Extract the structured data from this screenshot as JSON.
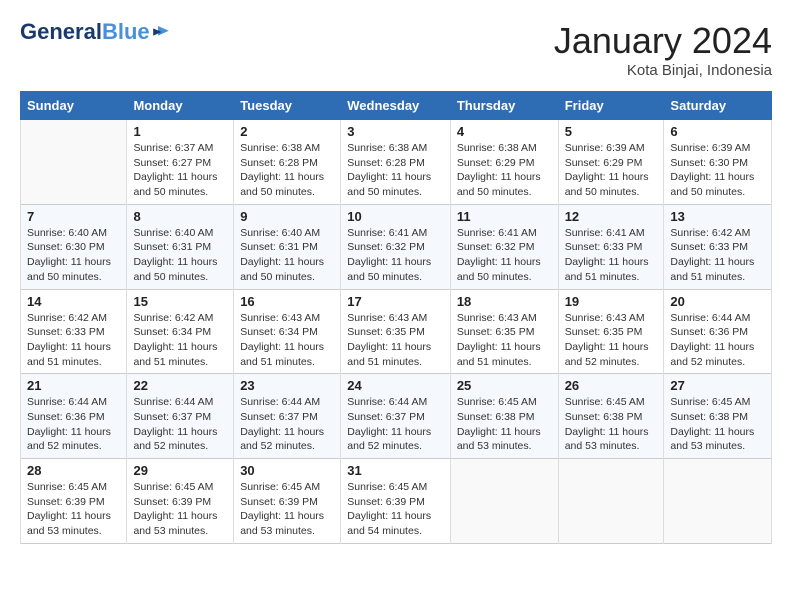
{
  "header": {
    "logo_line1": "General",
    "logo_line2": "Blue",
    "month_title": "January 2024",
    "location": "Kota Binjai, Indonesia"
  },
  "days_of_week": [
    "Sunday",
    "Monday",
    "Tuesday",
    "Wednesday",
    "Thursday",
    "Friday",
    "Saturday"
  ],
  "weeks": [
    [
      {
        "num": "",
        "info": ""
      },
      {
        "num": "1",
        "info": "Sunrise: 6:37 AM\nSunset: 6:27 PM\nDaylight: 11 hours\nand 50 minutes."
      },
      {
        "num": "2",
        "info": "Sunrise: 6:38 AM\nSunset: 6:28 PM\nDaylight: 11 hours\nand 50 minutes."
      },
      {
        "num": "3",
        "info": "Sunrise: 6:38 AM\nSunset: 6:28 PM\nDaylight: 11 hours\nand 50 minutes."
      },
      {
        "num": "4",
        "info": "Sunrise: 6:38 AM\nSunset: 6:29 PM\nDaylight: 11 hours\nand 50 minutes."
      },
      {
        "num": "5",
        "info": "Sunrise: 6:39 AM\nSunset: 6:29 PM\nDaylight: 11 hours\nand 50 minutes."
      },
      {
        "num": "6",
        "info": "Sunrise: 6:39 AM\nSunset: 6:30 PM\nDaylight: 11 hours\nand 50 minutes."
      }
    ],
    [
      {
        "num": "7",
        "info": "Sunrise: 6:40 AM\nSunset: 6:30 PM\nDaylight: 11 hours\nand 50 minutes."
      },
      {
        "num": "8",
        "info": "Sunrise: 6:40 AM\nSunset: 6:31 PM\nDaylight: 11 hours\nand 50 minutes."
      },
      {
        "num": "9",
        "info": "Sunrise: 6:40 AM\nSunset: 6:31 PM\nDaylight: 11 hours\nand 50 minutes."
      },
      {
        "num": "10",
        "info": "Sunrise: 6:41 AM\nSunset: 6:32 PM\nDaylight: 11 hours\nand 50 minutes."
      },
      {
        "num": "11",
        "info": "Sunrise: 6:41 AM\nSunset: 6:32 PM\nDaylight: 11 hours\nand 50 minutes."
      },
      {
        "num": "12",
        "info": "Sunrise: 6:41 AM\nSunset: 6:33 PM\nDaylight: 11 hours\nand 51 minutes."
      },
      {
        "num": "13",
        "info": "Sunrise: 6:42 AM\nSunset: 6:33 PM\nDaylight: 11 hours\nand 51 minutes."
      }
    ],
    [
      {
        "num": "14",
        "info": "Sunrise: 6:42 AM\nSunset: 6:33 PM\nDaylight: 11 hours\nand 51 minutes."
      },
      {
        "num": "15",
        "info": "Sunrise: 6:42 AM\nSunset: 6:34 PM\nDaylight: 11 hours\nand 51 minutes."
      },
      {
        "num": "16",
        "info": "Sunrise: 6:43 AM\nSunset: 6:34 PM\nDaylight: 11 hours\nand 51 minutes."
      },
      {
        "num": "17",
        "info": "Sunrise: 6:43 AM\nSunset: 6:35 PM\nDaylight: 11 hours\nand 51 minutes."
      },
      {
        "num": "18",
        "info": "Sunrise: 6:43 AM\nSunset: 6:35 PM\nDaylight: 11 hours\nand 51 minutes."
      },
      {
        "num": "19",
        "info": "Sunrise: 6:43 AM\nSunset: 6:35 PM\nDaylight: 11 hours\nand 52 minutes."
      },
      {
        "num": "20",
        "info": "Sunrise: 6:44 AM\nSunset: 6:36 PM\nDaylight: 11 hours\nand 52 minutes."
      }
    ],
    [
      {
        "num": "21",
        "info": "Sunrise: 6:44 AM\nSunset: 6:36 PM\nDaylight: 11 hours\nand 52 minutes."
      },
      {
        "num": "22",
        "info": "Sunrise: 6:44 AM\nSunset: 6:37 PM\nDaylight: 11 hours\nand 52 minutes."
      },
      {
        "num": "23",
        "info": "Sunrise: 6:44 AM\nSunset: 6:37 PM\nDaylight: 11 hours\nand 52 minutes."
      },
      {
        "num": "24",
        "info": "Sunrise: 6:44 AM\nSunset: 6:37 PM\nDaylight: 11 hours\nand 52 minutes."
      },
      {
        "num": "25",
        "info": "Sunrise: 6:45 AM\nSunset: 6:38 PM\nDaylight: 11 hours\nand 53 minutes."
      },
      {
        "num": "26",
        "info": "Sunrise: 6:45 AM\nSunset: 6:38 PM\nDaylight: 11 hours\nand 53 minutes."
      },
      {
        "num": "27",
        "info": "Sunrise: 6:45 AM\nSunset: 6:38 PM\nDaylight: 11 hours\nand 53 minutes."
      }
    ],
    [
      {
        "num": "28",
        "info": "Sunrise: 6:45 AM\nSunset: 6:39 PM\nDaylight: 11 hours\nand 53 minutes."
      },
      {
        "num": "29",
        "info": "Sunrise: 6:45 AM\nSunset: 6:39 PM\nDaylight: 11 hours\nand 53 minutes."
      },
      {
        "num": "30",
        "info": "Sunrise: 6:45 AM\nSunset: 6:39 PM\nDaylight: 11 hours\nand 53 minutes."
      },
      {
        "num": "31",
        "info": "Sunrise: 6:45 AM\nSunset: 6:39 PM\nDaylight: 11 hours\nand 54 minutes."
      },
      {
        "num": "",
        "info": ""
      },
      {
        "num": "",
        "info": ""
      },
      {
        "num": "",
        "info": ""
      }
    ]
  ]
}
